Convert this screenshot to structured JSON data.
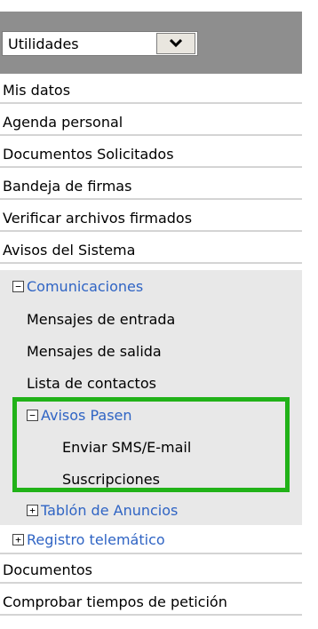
{
  "dropdown": {
    "selected": "Utilidades",
    "arrow_icon": "chevron-down-icon"
  },
  "colors": {
    "link": "#2f64c4",
    "highlight_border": "#21b218",
    "header_bg": "#8e8e8e",
    "submenu_bg": "#e8e8e8"
  },
  "menu": {
    "mis_datos": "Mis datos",
    "agenda": "Agenda personal",
    "documentos_solicitados": "Documentos Solicitados",
    "bandeja": "Bandeja de firmas",
    "verificar": "Verificar archivos firmados",
    "avisos_sistema": "Avisos del Sistema",
    "comunicaciones": {
      "toggle": "−",
      "label": "Comunicaciones"
    },
    "mensajes_entrada": "Mensajes de entrada",
    "mensajes_salida": "Mensajes de salida",
    "lista_contactos": "Lista de contactos",
    "avisos_pasen": {
      "toggle": "−",
      "label": "Avisos Pasen"
    },
    "enviar_sms": "Enviar SMS/E-mail",
    "suscripciones": "Suscripciones",
    "tablon": {
      "toggle": "+",
      "label": "Tablón de Anuncios"
    },
    "registro": {
      "toggle": "+",
      "label": "Registro telemático"
    },
    "documentos": "Documentos",
    "comprobar": "Comprobar tiempos de petición"
  }
}
